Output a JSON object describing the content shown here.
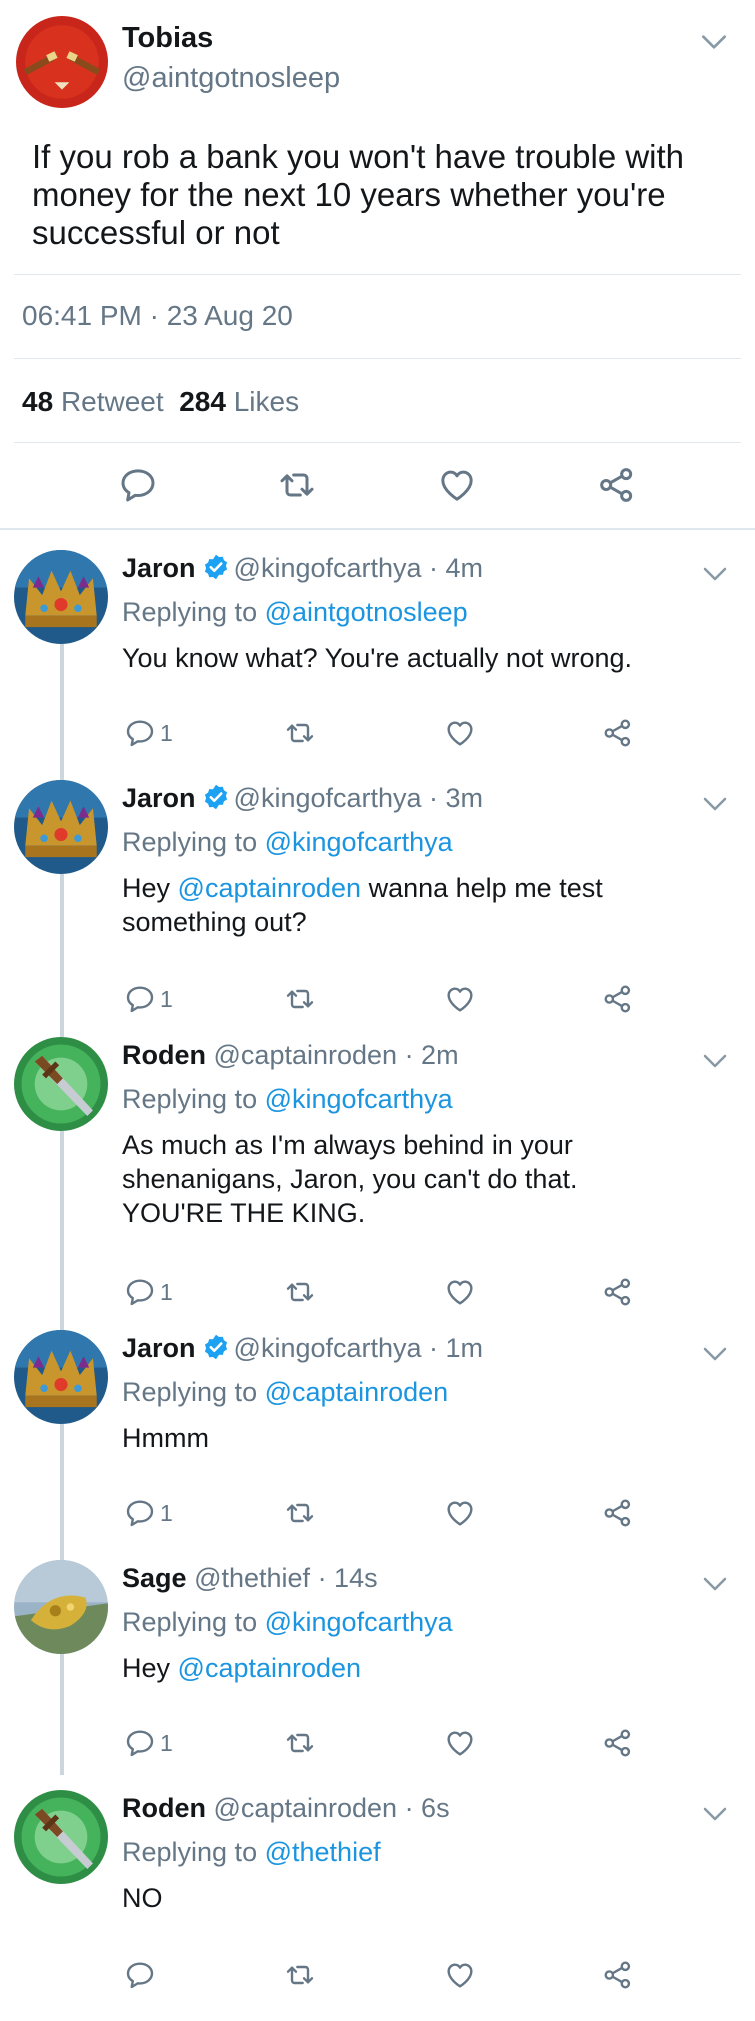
{
  "main_tweet": {
    "author_name": "Tobias",
    "author_handle": "@aintgotnosleep",
    "text": "If you rob a bank you won't have trouble with money for the next 10 years whether you're successful or not",
    "timestamp": "06:41 PM · 23 Aug 20",
    "retweets_count": "48",
    "retweets_label": "Retweet",
    "likes_count": "284",
    "likes_label": "Likes"
  },
  "replies": [
    {
      "name": "Jaron",
      "verified": true,
      "handle": "@kingofcarthya",
      "time": "· 4m",
      "replying_prefix": "Replying to",
      "replying_to": "@aintgotnosleep",
      "body_parts": [
        "You know what? You're actually not wrong."
      ],
      "reply_count": "1"
    },
    {
      "name": "Jaron",
      "verified": true,
      "handle": "@kingofcarthya",
      "time": "· 3m",
      "replying_prefix": "Replying to",
      "replying_to": "@kingofcarthya",
      "body_prefix": "Hey",
      "body_mention": "@captainroden",
      "body_suffix": "wanna help me test something out?",
      "reply_count": "1"
    },
    {
      "name": "Roden",
      "verified": false,
      "handle": "@captainroden",
      "time": "· 2m",
      "replying_prefix": "Replying to",
      "replying_to": "@kingofcarthya",
      "body_parts": [
        "As much as I'm always behind in your shenanigans, Jaron, you can't do that.",
        "YOU'RE THE KING."
      ],
      "reply_count": "1"
    },
    {
      "name": "Jaron",
      "verified": true,
      "handle": "@kingofcarthya",
      "time": "· 1m",
      "replying_prefix": "Replying to",
      "replying_to": "@captainroden",
      "body_parts": [
        "Hmmm"
      ],
      "reply_count": "1"
    },
    {
      "name": "Sage",
      "verified": false,
      "handle": "@thethief",
      "time": "· 14s",
      "replying_prefix": "Replying to",
      "replying_to": "@kingofcarthya",
      "body_prefix": "Hey",
      "body_mention": "@captainroden",
      "body_suffix": "",
      "reply_count": "1"
    },
    {
      "name": "Roden",
      "verified": false,
      "handle": "@captainroden",
      "time": "· 6s",
      "replying_prefix": "Replying to",
      "replying_to": "@thethief",
      "body_parts": [
        "NO"
      ],
      "reply_count": ""
    }
  ],
  "icons": {
    "reply": "reply-icon",
    "retweet": "retweet-icon",
    "like": "heart-icon",
    "share": "share-icon",
    "caret": "chevron-down-icon",
    "verified": "verified-badge-icon"
  },
  "colors": {
    "link": "#1b95e0",
    "secondary": "#657786",
    "divider": "#e1e8ed",
    "thread_line": "#ccd6dd",
    "verified": "#1da1f2"
  }
}
